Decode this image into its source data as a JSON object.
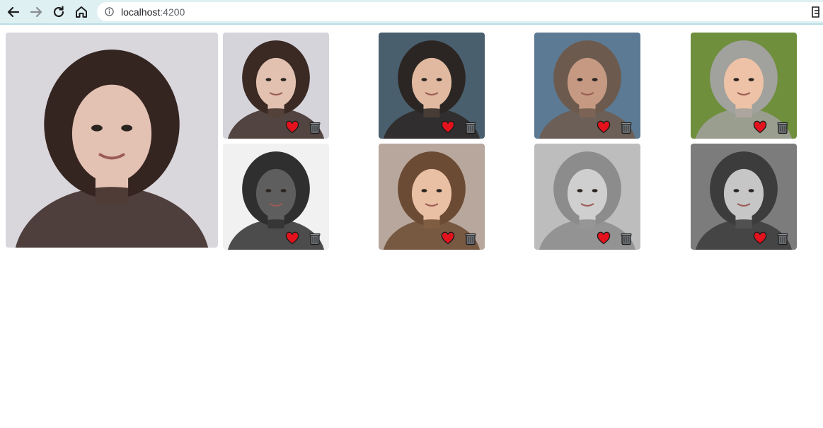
{
  "browser": {
    "url_host": "localhost",
    "url_port": ":4200",
    "icons": [
      "back-icon",
      "forward-icon",
      "reload-icon",
      "home-icon",
      "info-icon"
    ]
  },
  "gallery": {
    "featured": {
      "subject": "woman-long-dark-hair",
      "tone": "#c7b8b3",
      "bg": "#d9d6dc"
    },
    "tiles": [
      {
        "subject": "woman-long-dark-hair",
        "bg": "#d6d4db",
        "skin": "#e2c1b1",
        "hair": "#3b2a24",
        "liked": true
      },
      {
        "subject": "toddler-curly-hair",
        "bg": "#4a5f6e",
        "skin": "#e0b9a0",
        "hair": "#2b2623",
        "liked": true
      },
      {
        "subject": "man-smoke",
        "bg": "#5c7a93",
        "skin": "#c69a82",
        "hair": "#6d5a4e",
        "liked": true
      },
      {
        "subject": "boy-smiling",
        "bg": "#6f8f3c",
        "skin": "#edc2a6",
        "hair": "#a1a19d",
        "liked": true
      },
      {
        "subject": "man-cap-headphones",
        "bg": "#f1f1f1",
        "skin": "#5e5e5e",
        "hair": "#2f2f2f",
        "liked": true
      },
      {
        "subject": "young-man-beanie",
        "bg": "#b8a79d",
        "skin": "#e9c0a4",
        "hair": "#6b4b33",
        "liked": true
      },
      {
        "subject": "woman-blonde-bw",
        "bg": "#bdbdbd",
        "skin": "#cfcfcf",
        "hair": "#8c8c8c",
        "liked": true
      },
      {
        "subject": "woman-sunglasses-bw",
        "bg": "#7c7c7c",
        "skin": "#c6c6c6",
        "hair": "#3c3c3c",
        "liked": true
      }
    ]
  },
  "colors": {
    "heart": "#e3121d",
    "trash": "#6b6f73",
    "toolbar": "#dff0f3"
  }
}
